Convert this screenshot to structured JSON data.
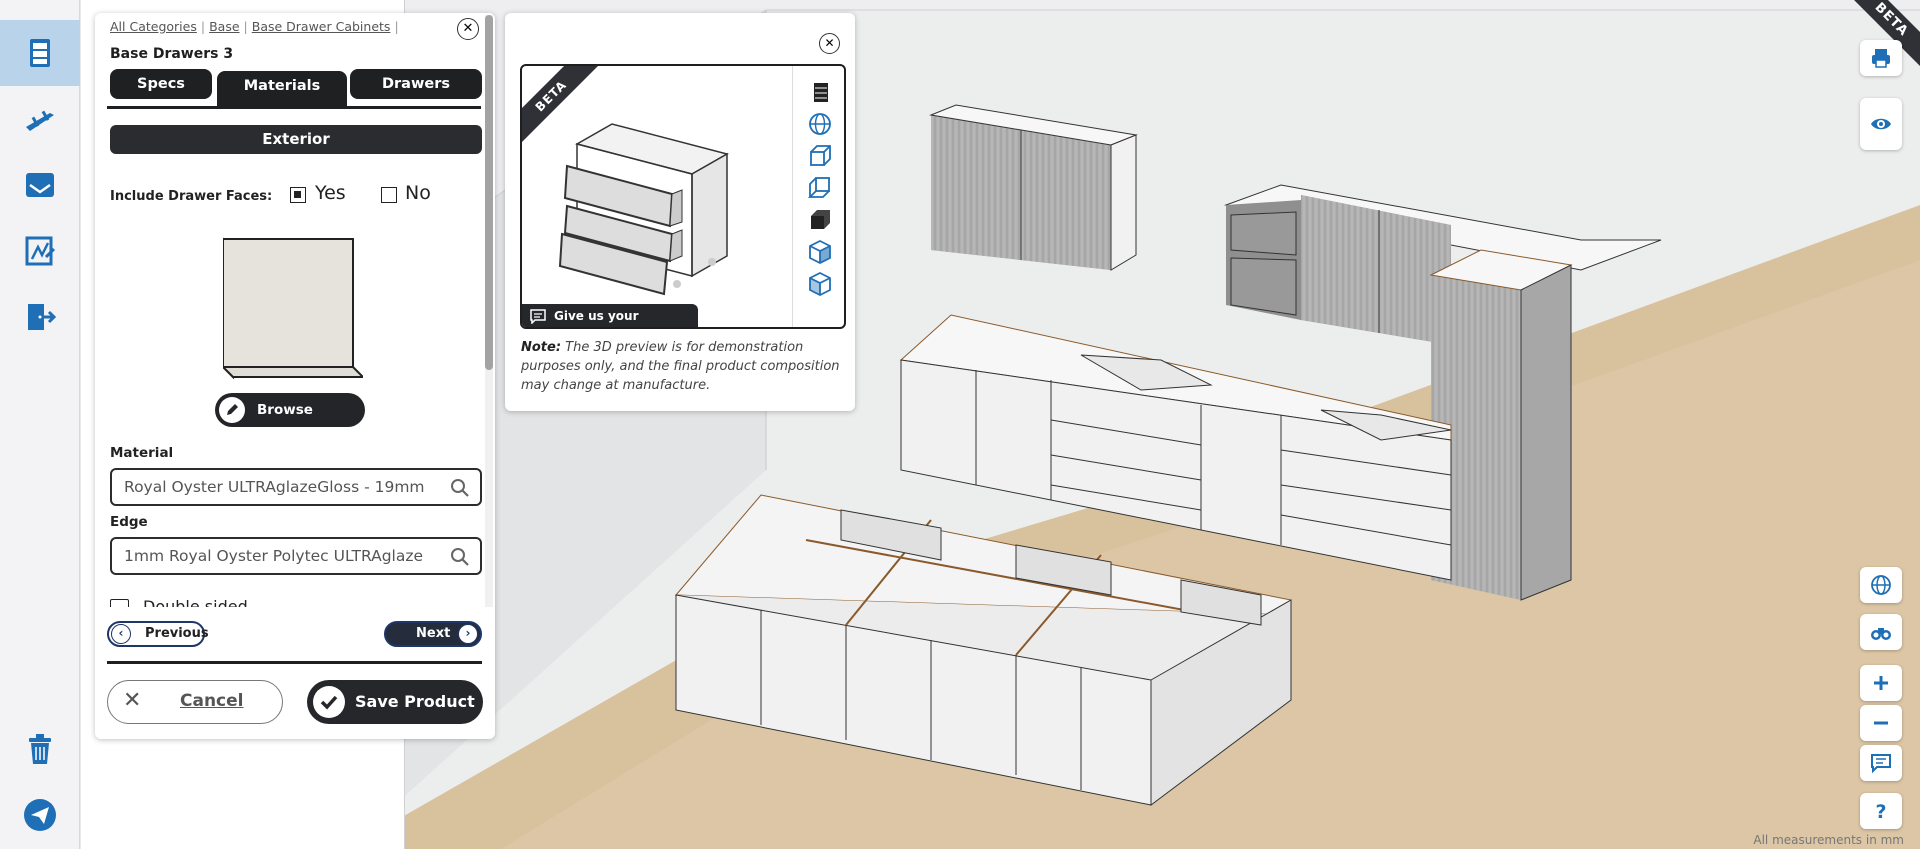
{
  "app": {
    "beta_ribbon": "BETA",
    "measurements_note": "All measurements in mm"
  },
  "colors": {
    "accent_blue": "#1e6fb5",
    "dark": "#25272b",
    "rail_active": "#b9d3ea"
  },
  "rail": {
    "items": [
      {
        "name": "cabinets",
        "icon": "cabinet-icon"
      },
      {
        "name": "hardware",
        "icon": "handle-icon"
      },
      {
        "name": "inbox",
        "icon": "tray-icon"
      },
      {
        "name": "design",
        "icon": "design-board-icon"
      },
      {
        "name": "exit",
        "icon": "exit-door-icon"
      }
    ],
    "bottom": [
      {
        "name": "delete",
        "icon": "trash-icon"
      },
      {
        "name": "send",
        "icon": "paper-plane-icon"
      }
    ]
  },
  "panel": {
    "breadcrumbs": [
      "All Categories",
      "Base",
      "Base Drawer Cabinets"
    ],
    "title": "Base Drawers 3",
    "tabs": [
      {
        "label": "Specs",
        "active": false
      },
      {
        "label": "Materials",
        "active": true
      },
      {
        "label": "Drawers",
        "active": false
      }
    ],
    "section_title": "Exterior",
    "drawer_faces": {
      "label": "Include Drawer Faces:",
      "yes_label": "Yes",
      "no_label": "No",
      "selected": "Yes"
    },
    "browse_label": "Browse Colours",
    "material": {
      "label": "Material",
      "value": "Royal Oyster ULTRAglazeGloss - 19mm"
    },
    "edge": {
      "label": "Edge",
      "value": "1mm Royal Oyster Polytec ULTRAglaze"
    },
    "double_sided_label": "Double sided",
    "nav": {
      "previous": "Previous",
      "next": "Next"
    },
    "cancel_label": "Cancel",
    "save_label": "Save Product"
  },
  "preview": {
    "beta_label": "BETA",
    "feedback_label": "Give us your Feedback",
    "note_bold": "Note:",
    "note_text": " The 3D preview is for demonstration purposes only, and the final product composition may change at manufacture.",
    "view_icons": [
      "solid-cabinet-icon",
      "globe-icon",
      "front-view-icon",
      "back-view-icon",
      "solid-cube-icon",
      "iso-view-icon",
      "iso-view-alt-icon"
    ]
  },
  "tools": {
    "top": [
      "print-icon",
      "eye-icon"
    ],
    "bottom": [
      "globe-icon",
      "binoculars-icon",
      "zoom-in-icon",
      "zoom-out-icon",
      "comment-icon",
      "help-icon"
    ]
  }
}
